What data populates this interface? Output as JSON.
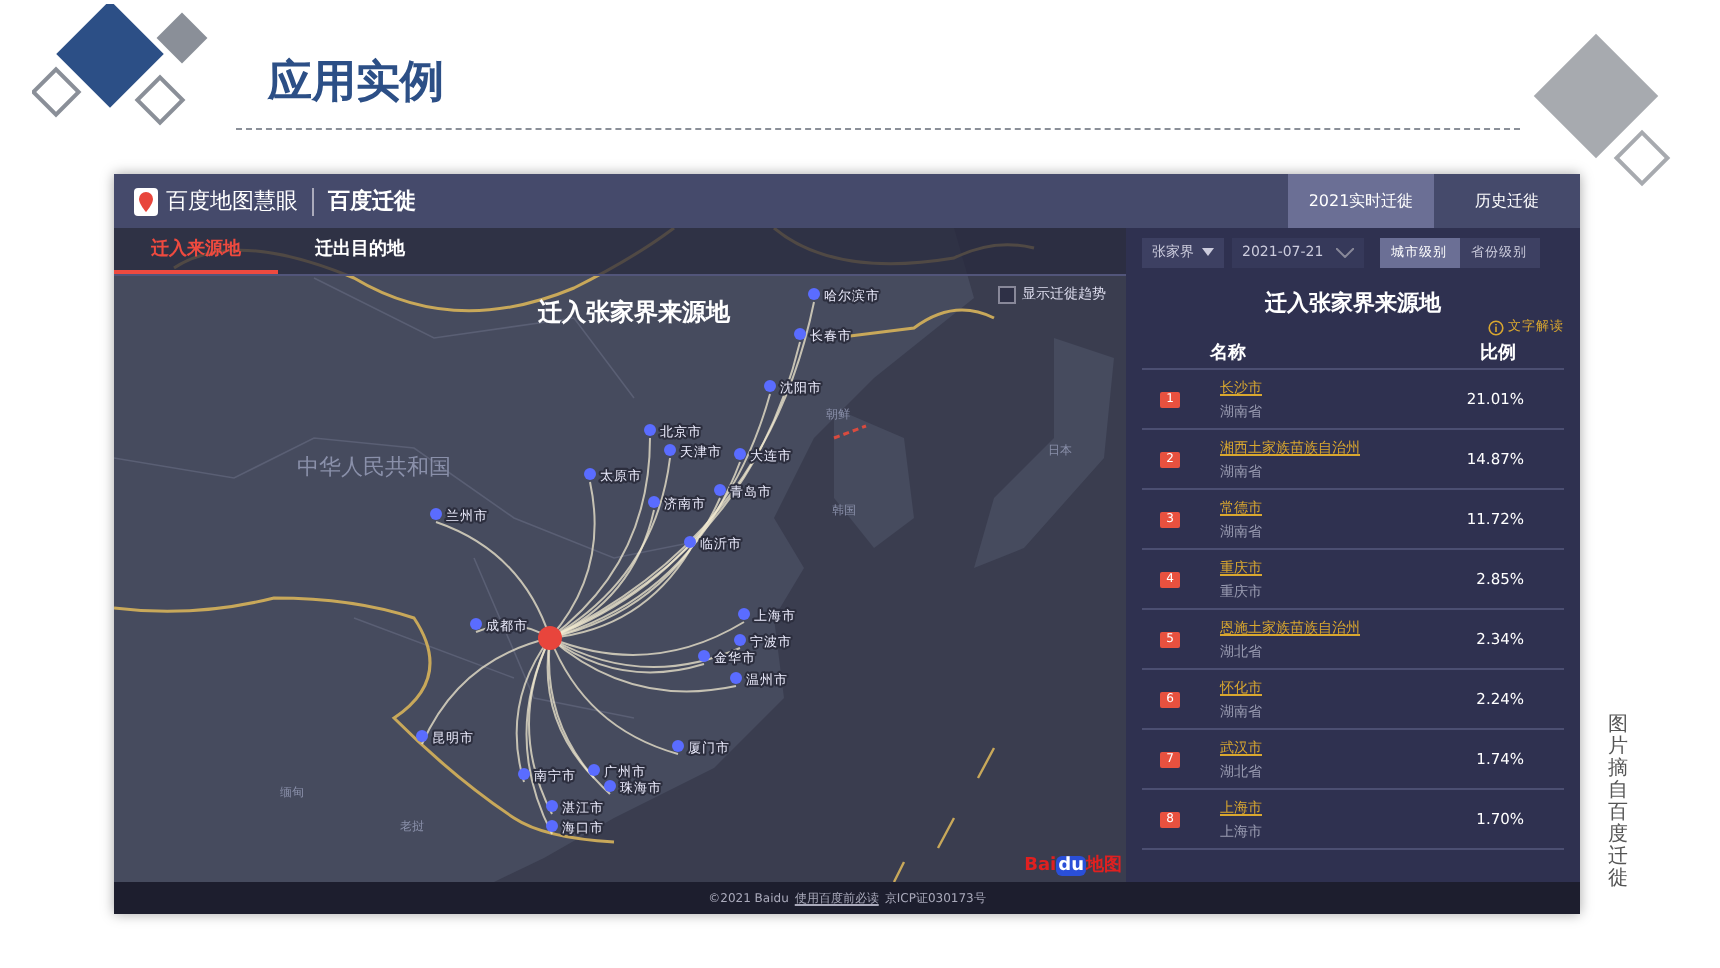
{
  "slide_title": "应用实例",
  "caption": "图片摘自百度迁徙",
  "app": {
    "brand": "百度地图慧眼",
    "product": "百度迁徙",
    "top_tabs": [
      {
        "label": "2021实时迁徙",
        "selected": true
      },
      {
        "label": "历史迁徙",
        "selected": false
      }
    ],
    "map_tabs": [
      {
        "label": "迁入来源地",
        "selected": true
      },
      {
        "label": "迁出目的地",
        "selected": false
      }
    ],
    "map_title": "迁入张家界来源地",
    "trend_toggle": {
      "label": "显示迁徙趋势",
      "checked": false
    },
    "country_labels": [
      "中华人民共和国",
      "朝鲜",
      "韩国",
      "日本",
      "缅甸",
      "老挝"
    ],
    "city_labels": [
      "哈尔滨市",
      "长春市",
      "沈阳市",
      "北京市",
      "天津市",
      "大连市",
      "太原市",
      "济南市",
      "青岛市",
      "临沂市",
      "兰州市",
      "成都市",
      "上海市",
      "宁波市",
      "金华市",
      "温州市",
      "厦门市",
      "广州市",
      "珠海市",
      "南宁市",
      "湛江市",
      "海口市",
      "昆明市"
    ],
    "map_logo": [
      "Bai",
      "du",
      "地图"
    ],
    "city_select": "张家界",
    "date": "2021-07-21",
    "level_tabs": [
      {
        "label": "城市级别",
        "selected": true
      },
      {
        "label": "省份级别",
        "selected": false
      }
    ],
    "panel_title": "迁入张家界来源地",
    "explain_link": "文字解读",
    "columns": [
      "名称",
      "比例"
    ],
    "rows": [
      {
        "rank": "1",
        "city": "长沙市",
        "province": "湖南省",
        "share": "21.01%"
      },
      {
        "rank": "2",
        "city": "湘西土家族苗族自治州",
        "province": "湖南省",
        "share": "14.87%"
      },
      {
        "rank": "3",
        "city": "常德市",
        "province": "湖南省",
        "share": "11.72%"
      },
      {
        "rank": "4",
        "city": "重庆市",
        "province": "重庆市",
        "share": "2.85%"
      },
      {
        "rank": "5",
        "city": "恩施土家族苗族自治州",
        "province": "湖北省",
        "share": "2.34%"
      },
      {
        "rank": "6",
        "city": "怀化市",
        "province": "湖南省",
        "share": "2.24%"
      },
      {
        "rank": "7",
        "city": "武汉市",
        "province": "湖北省",
        "share": "1.74%"
      },
      {
        "rank": "8",
        "city": "上海市",
        "province": "上海市",
        "share": "1.70%"
      }
    ],
    "footer": {
      "copyright": "©2021 Baidu",
      "link": "使用百度前必读",
      "icp": "京ICP证030173号"
    }
  }
}
